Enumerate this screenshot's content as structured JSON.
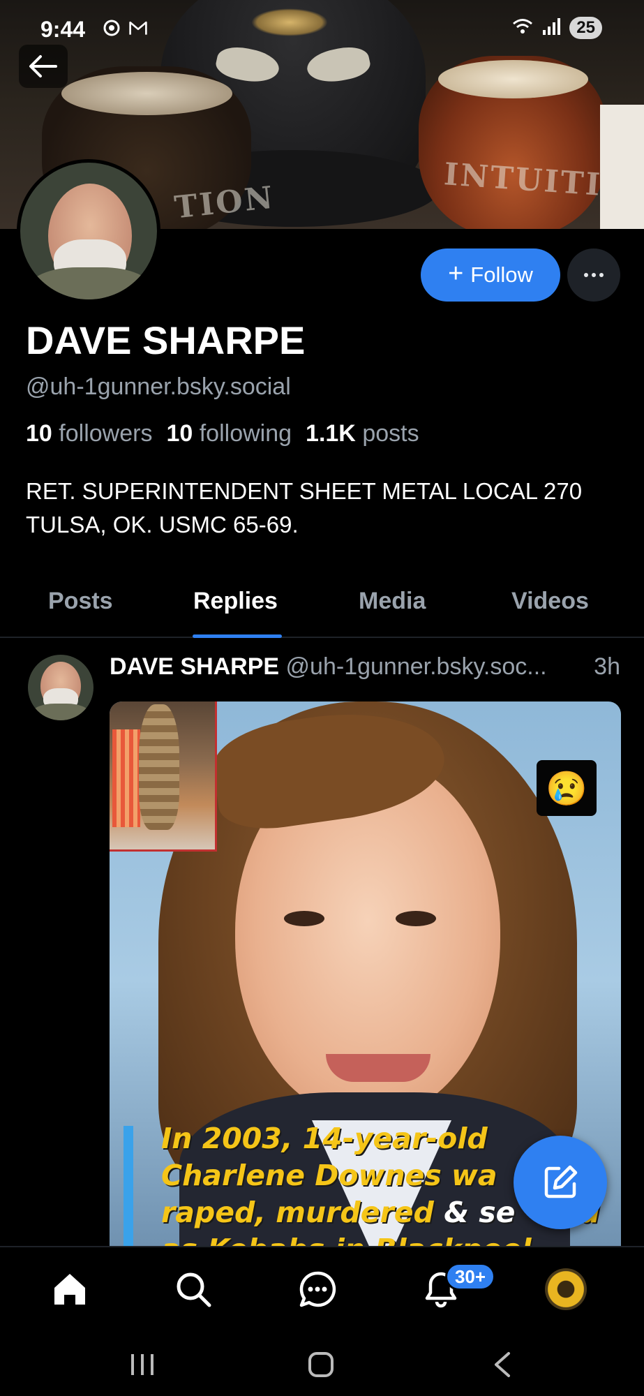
{
  "status_bar": {
    "time": "9:44",
    "battery": "25",
    "left_icons": [
      "sync-icon",
      "gmail-icon"
    ],
    "right_icons": [
      "wifi-icon",
      "signal-icon"
    ]
  },
  "banner": {
    "glass_text_left": "TION",
    "glass_text_right": "INTUITION"
  },
  "profile": {
    "display_name": "DAVE SHARPE",
    "handle": "@uh-1gunner.bsky.social",
    "followers_count": "10",
    "followers_label": "followers",
    "following_count": "10",
    "following_label": "following",
    "posts_count": "1.1K",
    "posts_label": "posts",
    "bio": "RET. SUPERINTENDENT SHEET METAL LOCAL 270 TULSA, OK.  USMC 65-69."
  },
  "actions": {
    "follow_plus": "+",
    "follow_label": "Follow"
  },
  "tabs": [
    {
      "label": "Posts",
      "active": false
    },
    {
      "label": "Replies",
      "active": true
    },
    {
      "label": "Media",
      "active": false
    },
    {
      "label": "Videos",
      "active": false
    }
  ],
  "post": {
    "author": "DAVE SHARPE",
    "handle": "@uh-1gunner.bsky.soc...",
    "time": "3h",
    "emoji": "😢",
    "caption_line1": "In 2003, 14-year-old",
    "caption_line2": "Charlene Downes wa",
    "caption_line3a": "raped, murdered",
    "caption_line3b": "& se",
    "caption_line3c": "ed",
    "caption_line4": "as Kebabs in Blackpool"
  },
  "bottom_nav": {
    "items": [
      "home-icon",
      "search-icon",
      "chat-icon",
      "bell-icon",
      "profile-avatar"
    ],
    "notifications_badge": "30+"
  },
  "colors": {
    "accent": "#2f80f1",
    "background": "#000000",
    "muted_text": "#9aa3ad"
  }
}
